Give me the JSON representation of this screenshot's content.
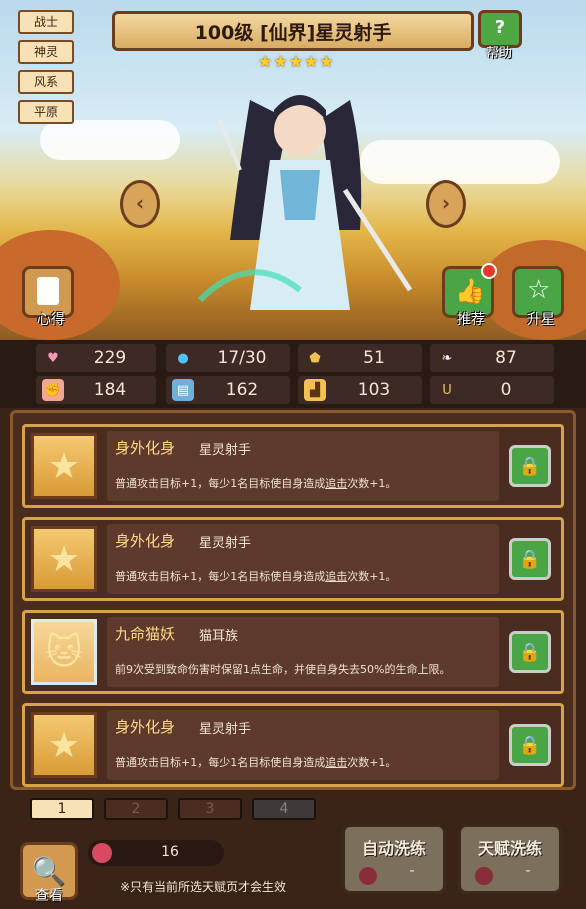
{
  "tags": [
    "战士",
    "神灵",
    "风系",
    "平原"
  ],
  "title": "100级 [仙界]星灵射手",
  "help_label": "帮助",
  "star_count": 5,
  "left_button_label": "心得",
  "recommend_label": "推荐",
  "upgrade_label": "升星",
  "stats": [
    {
      "icon": "heart-icon",
      "value": "229"
    },
    {
      "icon": "water-drop-icon",
      "value": "17/30"
    },
    {
      "icon": "shield-icon",
      "value": "51"
    },
    {
      "icon": "wing-icon",
      "value": "87"
    },
    {
      "icon": "fist-icon",
      "value": "184"
    },
    {
      "icon": "book-icon",
      "value": "162"
    },
    {
      "icon": "boot-icon",
      "value": "103"
    },
    {
      "icon": "magnet-icon",
      "value": "0"
    }
  ],
  "talents": [
    {
      "name": "身外化身",
      "sub": "星灵射手",
      "desc_a": "普通攻击目标+1，每少1名目标使自身造成",
      "desc_u": "追击",
      "desc_b": "次数+1。",
      "icon": "star-icon"
    },
    {
      "name": "身外化身",
      "sub": "星灵射手",
      "desc_a": "普通攻击目标+1，每少1名目标使自身造成",
      "desc_u": "追击",
      "desc_b": "次数+1。",
      "icon": "star-icon"
    },
    {
      "name": "九命猫妖",
      "sub": "猫耳族",
      "desc_a": "前9次受到致命伤害时保留1点生命，并使自身失去50%的生命上限。",
      "desc_u": "",
      "desc_b": "",
      "icon": "cat-icon"
    },
    {
      "name": "身外化身",
      "sub": "星灵射手",
      "desc_a": "普通攻击目标+1，每少1名目标使自身造成",
      "desc_u": "追击",
      "desc_b": "次数+1。",
      "icon": "star-icon"
    }
  ],
  "pages": [
    "1",
    "2",
    "3",
    "4"
  ],
  "view_label": "查看",
  "resource_value": "16",
  "note": "※只有当前所选天赋页才会生效",
  "auto_label": "自动洗练",
  "auto_cost": "-",
  "talent_label": "天赋洗练",
  "talent_cost": "-"
}
